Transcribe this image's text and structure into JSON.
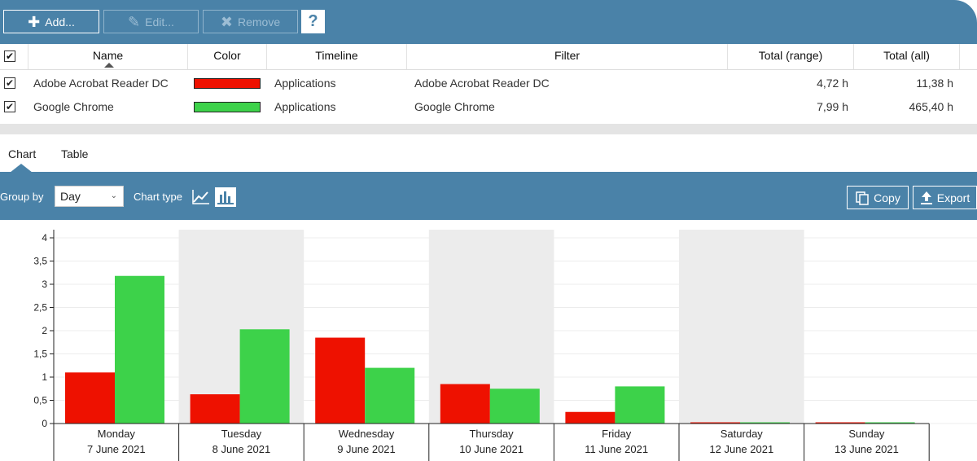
{
  "toolbar": {
    "add_label": "Add...",
    "edit_label": "Edit...",
    "remove_label": "Remove",
    "help_label": "?"
  },
  "grid": {
    "headers": {
      "name": "Name",
      "color": "Color",
      "timeline": "Timeline",
      "filter": "Filter",
      "total_range": "Total (range)",
      "total_all": "Total (all)"
    },
    "rows": [
      {
        "checked": true,
        "name": "Adobe Acrobat Reader DC",
        "color": "#ee1100",
        "timeline": "Applications",
        "filter": "Adobe Acrobat Reader DC",
        "total_range": "4,72 h",
        "total_all": "11,38 h"
      },
      {
        "checked": true,
        "name": "Google Chrome",
        "color": "#3dd24a",
        "timeline": "Applications",
        "filter": "Google Chrome",
        "total_range": "7,99 h",
        "total_all": "465,40 h"
      }
    ]
  },
  "tabs": {
    "chart": "Chart",
    "table": "Table",
    "active": "chart"
  },
  "options": {
    "group_by_label": "Group by",
    "group_by_value": "Day",
    "chart_type_label": "Chart type",
    "chart_type_selected": "bar",
    "copy_label": "Copy",
    "export_label": "Export"
  },
  "chart_data": {
    "type": "bar",
    "categories": [
      "Monday",
      "Tuesday",
      "Wednesday",
      "Thursday",
      "Friday",
      "Saturday",
      "Sunday"
    ],
    "dates": [
      "7 June 2021",
      "8 June 2021",
      "9 June 2021",
      "10 June 2021",
      "11 June 2021",
      "12 June 2021",
      "13 June 2021"
    ],
    "series": [
      {
        "name": "Adobe Acrobat Reader DC",
        "color": "#ee1100",
        "values": [
          1.1,
          0.63,
          1.85,
          0.85,
          0.25,
          0,
          0
        ]
      },
      {
        "name": "Google Chrome",
        "color": "#3dd24a",
        "values": [
          3.18,
          2.03,
          1.2,
          0.75,
          0.8,
          0,
          0
        ]
      }
    ],
    "ylim": [
      0,
      4
    ],
    "yticks": [
      "0",
      "0,5",
      "1",
      "1,5",
      "2",
      "2,5",
      "3",
      "3,5",
      "4"
    ],
    "shaded_bands": "alternate days",
    "band_color": "#ececec"
  }
}
